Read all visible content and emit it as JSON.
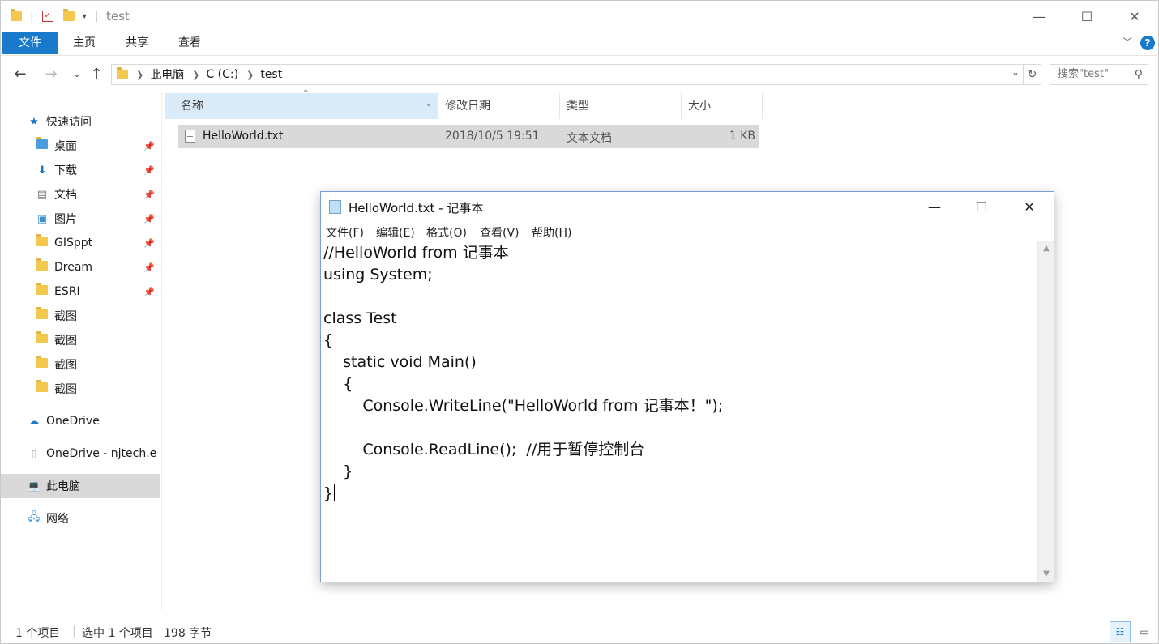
{
  "explorer": {
    "title": "test",
    "ribbon_tabs": [
      "文件",
      "主页",
      "共享",
      "查看"
    ],
    "address": {
      "segments": [
        "此电脑",
        "C (C:)",
        "test"
      ]
    },
    "search_placeholder": "搜索\"test\"",
    "sidebar": {
      "quick_access": "快速访问",
      "pinned": [
        {
          "label": "桌面",
          "icon": "desktop-folder-icon"
        },
        {
          "label": "下载",
          "icon": "downloads-folder-icon"
        },
        {
          "label": "文档",
          "icon": "documents-folder-icon"
        },
        {
          "label": "图片",
          "icon": "pictures-folder-icon"
        },
        {
          "label": "GISppt",
          "icon": "folder-icon"
        },
        {
          "label": "Dream",
          "icon": "folder-icon"
        },
        {
          "label": "ESRI",
          "icon": "folder-icon"
        }
      ],
      "folders": [
        "截图",
        "截图",
        "截图",
        "截图"
      ],
      "onedrive": "OneDrive",
      "onedrive_business": "OneDrive - njtech.e",
      "this_pc": "此电脑",
      "network": "网络"
    },
    "columns": [
      "名称",
      "修改日期",
      "类型",
      "大小"
    ],
    "files": [
      {
        "name": "HelloWorld.txt",
        "modified": "2018/10/5 19:51",
        "type": "文本文档",
        "size": "1 KB"
      }
    ],
    "status": {
      "count": "1 个项目",
      "selected": "选中 1 个项目",
      "size": "198 字节"
    }
  },
  "notepad": {
    "title": "HelloWorld.txt - 记事本",
    "menu": [
      "文件(F)",
      "编辑(E)",
      "格式(O)",
      "查看(V)",
      "帮助(H)"
    ],
    "lines": [
      "//HelloWorld from 记事本",
      "using System;",
      "",
      "class Test",
      "{",
      "    static void Main()",
      "    {",
      "        Console.WriteLine(\"HelloWorld from 记事本！\");",
      "",
      "        Console.ReadLine();  //用于暂停控制台",
      "    }",
      "}"
    ]
  },
  "colors": {
    "accent": "#1979ca",
    "selection": "#d9d9d9",
    "header_hover": "#d9ebf9"
  }
}
